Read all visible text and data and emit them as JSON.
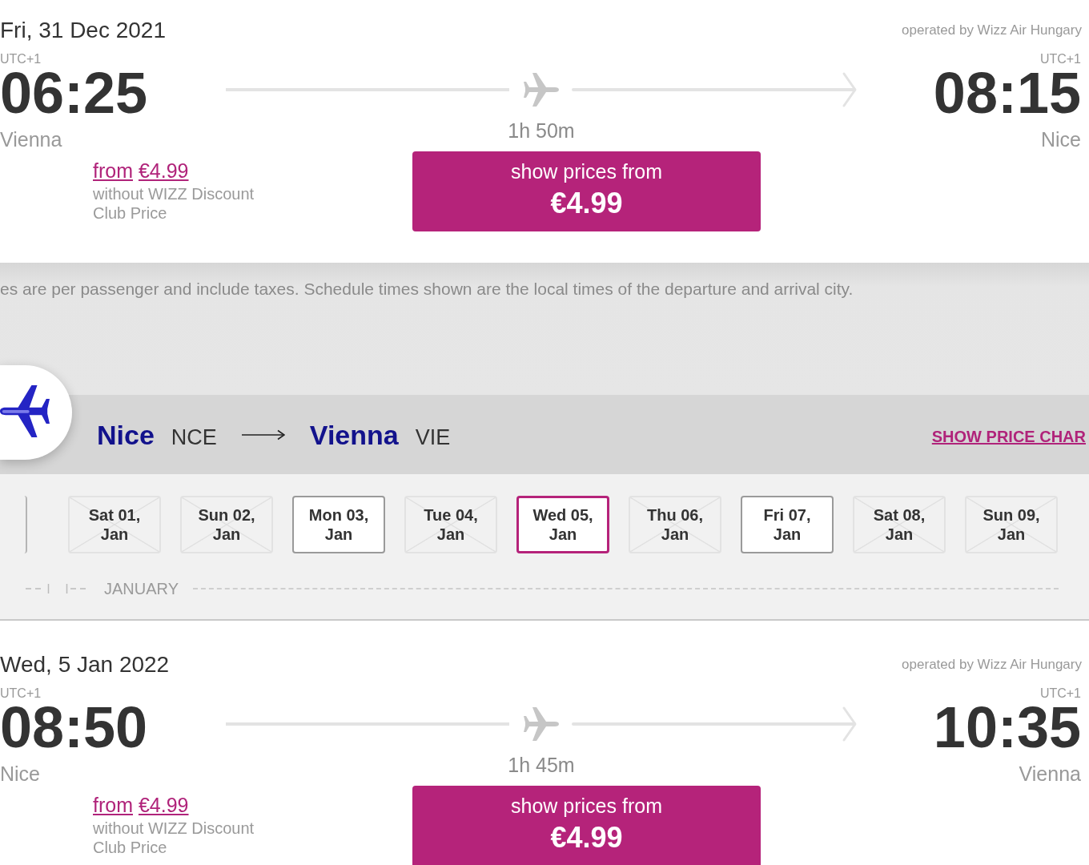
{
  "outbound_flight": {
    "date": "Fri, 31 Dec 2021",
    "operator": "operated by Wizz Air Hungary",
    "departure": {
      "utc": "UTC+1",
      "time": "06:25",
      "city": "Vienna"
    },
    "arrival": {
      "utc": "UTC+1",
      "time": "08:15",
      "city": "Nice"
    },
    "duration": "1h 50m",
    "fare": {
      "from_label": "from",
      "price": "€4.99",
      "note": "without WIZZ Discount Club Price"
    },
    "price_button": {
      "label": "show prices from",
      "price": "€4.99"
    }
  },
  "notice": "es are per passenger and include taxes. Schedule times shown are the local times of the departure and arrival city.",
  "return_route": {
    "origin": {
      "city": "Nice",
      "code": "NCE"
    },
    "destination": {
      "city": "Vienna",
      "code": "VIE"
    },
    "price_chart_link": "SHOW PRICE CHAR"
  },
  "date_picker": {
    "days": [
      {
        "label": "Sat 01, Jan",
        "available": false,
        "selected": false
      },
      {
        "label": "Sun 02, Jan",
        "available": false,
        "selected": false
      },
      {
        "label": "Mon 03, Jan",
        "available": true,
        "selected": false
      },
      {
        "label": "Tue 04, Jan",
        "available": false,
        "selected": false
      },
      {
        "label": "Wed 05, Jan",
        "available": true,
        "selected": true
      },
      {
        "label": "Thu 06, Jan",
        "available": false,
        "selected": false
      },
      {
        "label": "Fri 07, Jan",
        "available": true,
        "selected": false
      },
      {
        "label": "Sat 08, Jan",
        "available": false,
        "selected": false
      },
      {
        "label": "Sun 09, Jan",
        "available": false,
        "selected": false
      }
    ],
    "month": "JANUARY"
  },
  "return_flight": {
    "date": "Wed, 5 Jan 2022",
    "operator": "operated by Wizz Air Hungary",
    "departure": {
      "utc": "UTC+1",
      "time": "08:50",
      "city": "Nice"
    },
    "arrival": {
      "utc": "UTC+1",
      "time": "10:35",
      "city": "Vienna"
    },
    "duration": "1h 45m",
    "fare": {
      "from_label": "from",
      "price": "€4.99",
      "note": "without WIZZ Discount Club Price"
    },
    "price_button": {
      "label": "show prices from",
      "price": "€4.99"
    }
  }
}
